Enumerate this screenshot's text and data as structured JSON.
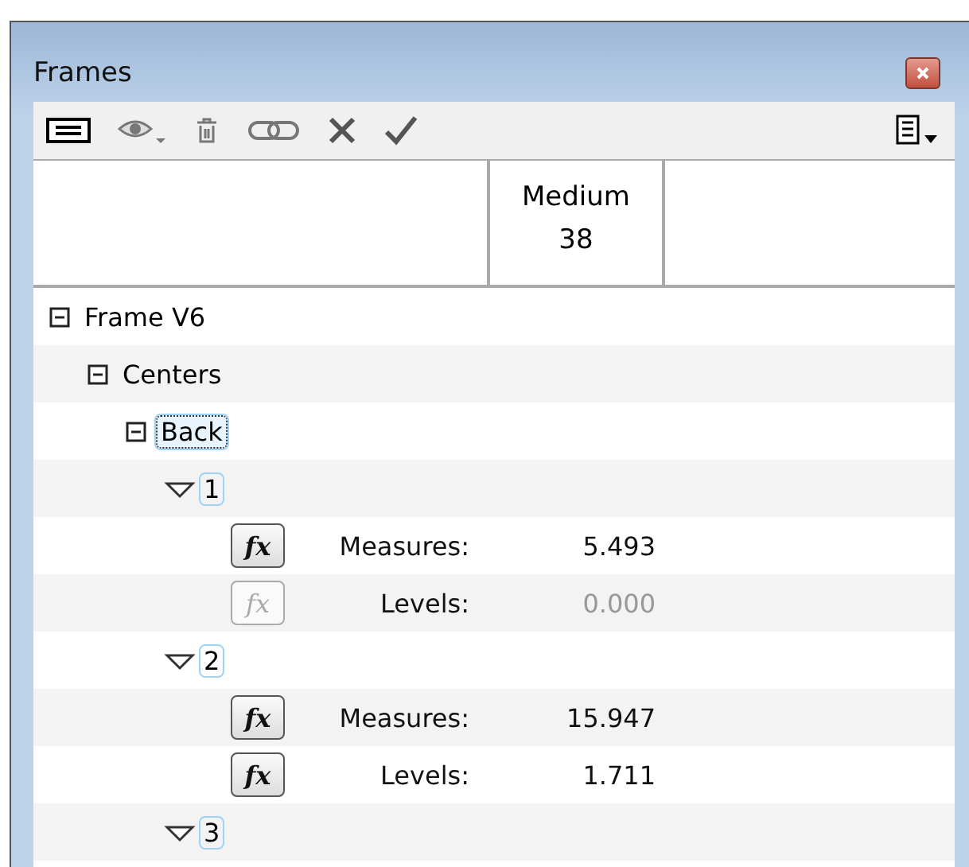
{
  "window": {
    "title": "Frames"
  },
  "toolbar": {
    "buttons": [
      {
        "kind": "list"
      },
      {
        "kind": "eye"
      },
      {
        "kind": "trash"
      },
      {
        "kind": "link"
      },
      {
        "kind": "cross"
      },
      {
        "kind": "check"
      }
    ],
    "menu": {
      "kind": "options"
    }
  },
  "table": {
    "columns": [
      {
        "label": "Medium\n38"
      }
    ],
    "tree": [
      {
        "kind": "folder",
        "label": "Frame V6",
        "expanded": true,
        "focused": false,
        "children": [
          {
            "kind": "folder",
            "label": "Centers",
            "expanded": true,
            "focused": false,
            "children": [
              {
                "kind": "folder",
                "label": "Back",
                "expanded": true,
                "focused": true,
                "children": [
                  {
                    "kind": "set",
                    "label": "1",
                    "expanded": true,
                    "children": [
                      {
                        "kind": "value",
                        "fx": "fx",
                        "label": "Measures:",
                        "value": "5.493",
                        "disabled": false
                      },
                      {
                        "kind": "value",
                        "fx": "fx",
                        "label": "Levels:",
                        "value": "0.000",
                        "disabled": true
                      }
                    ]
                  },
                  {
                    "kind": "set",
                    "label": "2",
                    "expanded": true,
                    "children": [
                      {
                        "kind": "value",
                        "fx": "fx",
                        "label": "Measures:",
                        "value": "15.947",
                        "disabled": false
                      },
                      {
                        "kind": "value",
                        "fx": "fx",
                        "label": "Levels:",
                        "value": "1.711",
                        "disabled": false
                      }
                    ]
                  },
                  {
                    "kind": "set",
                    "label": "3",
                    "expanded": true
                  }
                ]
              }
            ]
          }
        ]
      }
    ]
  }
}
